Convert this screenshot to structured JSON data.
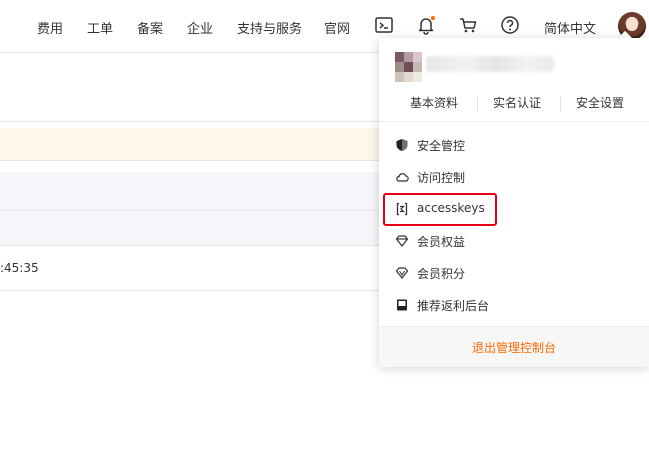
{
  "topnav": {
    "items": [
      "费用",
      "工单",
      "备案",
      "企业",
      "支持与服务",
      "官网"
    ],
    "icons": [
      "terminal-icon",
      "bell-icon",
      "cart-icon",
      "help-icon"
    ],
    "language": "简体中文",
    "notification_color": "#ff6a00"
  },
  "main": {
    "time_fragment": ":45:35"
  },
  "account_menu": {
    "top_links": [
      "基本资料",
      "实名认证",
      "安全设置"
    ],
    "items": [
      {
        "label": "安全管控",
        "icon": "shield-icon"
      },
      {
        "label": "访问控制",
        "icon": "cloud-icon"
      },
      {
        "label": "accesskeys",
        "icon": "key-bracket-icon"
      },
      {
        "label": "会员权益",
        "icon": "diamond-icon"
      },
      {
        "label": "会员积分",
        "icon": "gem-icon"
      },
      {
        "label": "推荐返利后台",
        "icon": "monitor-icon"
      }
    ],
    "highlight_color": "#e60012",
    "logout_label": "退出管理控制台",
    "logout_color": "#ff6a00"
  }
}
